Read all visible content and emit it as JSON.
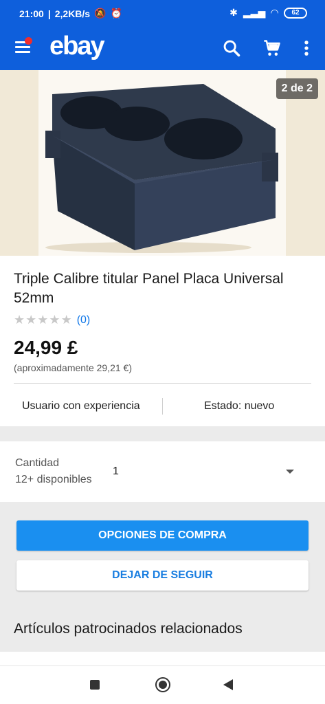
{
  "status_bar": {
    "time": "21:00",
    "network_speed": "2,2KB/s",
    "battery": "62"
  },
  "app": {
    "logo": "ebay",
    "icons": [
      "menu-icon",
      "search-icon",
      "cart-icon",
      "more-vert-icon"
    ]
  },
  "gallery": {
    "counter": "2 de 2"
  },
  "item": {
    "title": "Triple Calibre titular Panel Placa Universal 52mm",
    "rating_count": "(0)",
    "price": "24,99 £",
    "approx_price": "(aproximadamente 29,21 €)",
    "seller": "Usuario con experiencia",
    "condition": "Estado: nuevo"
  },
  "quantity": {
    "label": "Cantidad",
    "available": "12+ disponibles",
    "value": "1"
  },
  "actions": {
    "buy_options": "OPCIONES DE COMPRA",
    "unfollow": "DEJAR DE SEGUIR"
  },
  "related": {
    "title": "Artículos patrocinados relacionados"
  },
  "colors": {
    "brand_blue": "#0e5fdc",
    "button_blue": "#1a8ff0",
    "link_blue": "#0e76e8"
  }
}
